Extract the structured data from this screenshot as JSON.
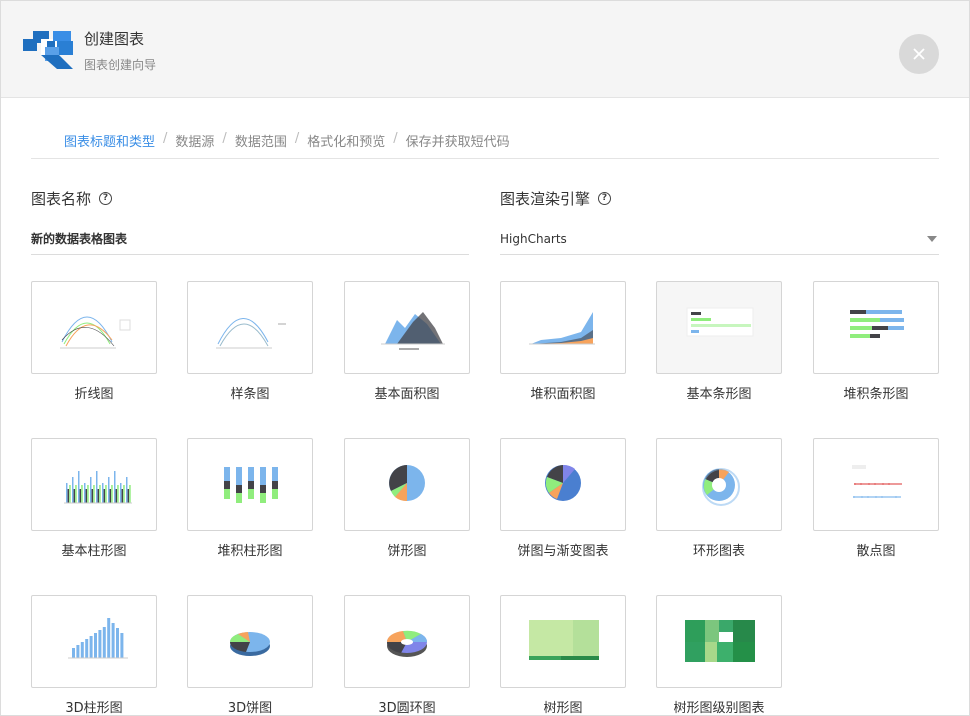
{
  "header": {
    "title": "创建图表",
    "subtitle": "图表创建向导"
  },
  "steps": [
    "图表标题和类型",
    "数据源",
    "数据范围",
    "格式化和预览",
    "保存并获取短代码"
  ],
  "active_step": 0,
  "chart_name": {
    "label": "图表名称",
    "value": "新的数据表格图表"
  },
  "engine": {
    "label": "图表渲染引擎",
    "value": "HighCharts"
  },
  "chart_types": [
    {
      "id": "line",
      "label": "折线图"
    },
    {
      "id": "spline",
      "label": "样条图"
    },
    {
      "id": "area",
      "label": "基本面积图"
    },
    {
      "id": "stacked-area",
      "label": "堆积面积图"
    },
    {
      "id": "bar",
      "label": "基本条形图"
    },
    {
      "id": "stacked-bar",
      "label": "堆积条形图"
    },
    {
      "id": "column",
      "label": "基本柱形图"
    },
    {
      "id": "stacked-column",
      "label": "堆积柱形图"
    },
    {
      "id": "pie",
      "label": "饼形图"
    },
    {
      "id": "pie-gradient",
      "label": "饼图与渐变图表"
    },
    {
      "id": "donut",
      "label": "环形图表"
    },
    {
      "id": "scatter",
      "label": "散点图"
    },
    {
      "id": "3d-column",
      "label": "3D柱形图"
    },
    {
      "id": "3d-pie",
      "label": "3D饼图"
    },
    {
      "id": "3d-donut",
      "label": "3D圆环图"
    },
    {
      "id": "treemap",
      "label": "树形图"
    },
    {
      "id": "treemap-levels",
      "label": "树形图级别图表"
    }
  ],
  "selected_chart_type": "bar",
  "colors": {
    "accent": "#3a8ee6",
    "series_blue": "#7cb5ec",
    "series_dark": "#434348",
    "series_green": "#90ed7d",
    "series_orange": "#f7a35c",
    "series_purple": "#8085e9"
  }
}
